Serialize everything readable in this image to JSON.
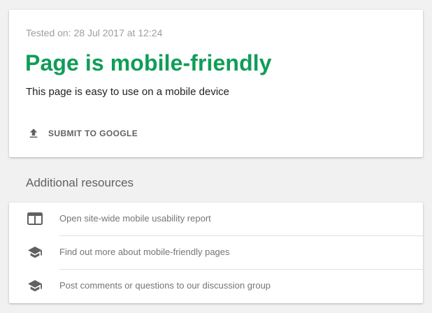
{
  "result": {
    "tested_on": "Tested on: 28 Jul 2017 at 12:24",
    "title": "Page is mobile-friendly",
    "description": "This page is easy to use on a mobile device",
    "submit_label": "SUBMIT TO GOOGLE",
    "submit_icon": "upload-icon"
  },
  "resources": {
    "heading": "Additional resources",
    "items": [
      {
        "label": "Open site-wide mobile usability report",
        "icon": "web-report-icon"
      },
      {
        "label": "Find out more about mobile-friendly pages",
        "icon": "school-icon"
      },
      {
        "label": "Post comments or questions to our discussion group",
        "icon": "school-icon"
      }
    ]
  },
  "colors": {
    "success_green": "#0f9d58",
    "background": "#f1f1f1",
    "card": "#ffffff",
    "muted_text": "#9e9e9e",
    "icon_gray": "#616161"
  }
}
